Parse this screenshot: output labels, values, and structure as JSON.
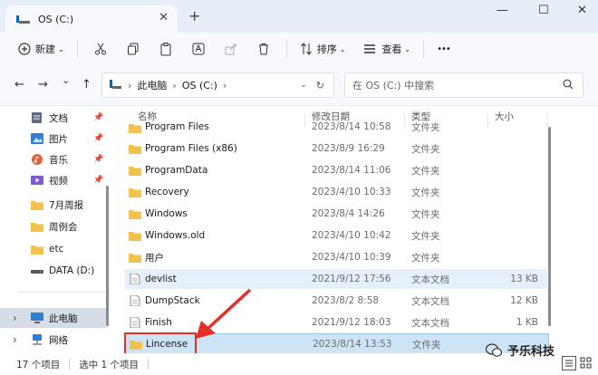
{
  "titlebar": {
    "tab_title": "OS (C:)",
    "close": "✕",
    "new_tab": "+",
    "minimize": "—",
    "maximize": "☐",
    "window_close": "✕"
  },
  "toolbar": {
    "new_label": "新建",
    "sort_label": "排序",
    "view_label": "查看",
    "more": "•••"
  },
  "address": {
    "back": "←",
    "forward": "→",
    "dropdown": "⌄",
    "up": "↑",
    "crumbs": [
      "此电脑",
      "OS (C:)"
    ],
    "sep": "›",
    "refresh": "↻"
  },
  "search": {
    "placeholder": "在 OS (C:) 中搜索"
  },
  "sidebar": {
    "items": [
      {
        "label": "文档",
        "icon": "document-icon",
        "pinned": true
      },
      {
        "label": "图片",
        "icon": "picture-icon",
        "pinned": true
      },
      {
        "label": "音乐",
        "icon": "music-icon",
        "pinned": true
      },
      {
        "label": "视频",
        "icon": "video-icon",
        "pinned": true
      },
      {
        "label": "7月周报",
        "icon": "folder-icon",
        "pinned": false
      },
      {
        "label": "周例会",
        "icon": "folder-icon",
        "pinned": false
      },
      {
        "label": "etc",
        "icon": "folder-icon",
        "pinned": false
      },
      {
        "label": "DATA (D:)",
        "icon": "drive-icon",
        "pinned": false
      },
      {
        "label": "此电脑",
        "icon": "computer-icon",
        "pinned": false,
        "selected": true
      },
      {
        "label": "网络",
        "icon": "network-icon",
        "pinned": false
      }
    ],
    "pin_glyph": "📌",
    "expand_glyph": "›"
  },
  "columns": {
    "name": "名称",
    "date": "修改日期",
    "type": "类型",
    "size": "大小"
  },
  "rows": [
    {
      "name": "Program Files",
      "date": "2023/8/14 10:58",
      "type": "文件夹",
      "size": "",
      "kind": "folder"
    },
    {
      "name": "Program Files (x86)",
      "date": "2023/8/9 16:29",
      "type": "文件夹",
      "size": "",
      "kind": "folder"
    },
    {
      "name": "ProgramData",
      "date": "2023/8/14 11:06",
      "type": "文件夹",
      "size": "",
      "kind": "folder"
    },
    {
      "name": "Recovery",
      "date": "2023/4/10 10:33",
      "type": "文件夹",
      "size": "",
      "kind": "folder"
    },
    {
      "name": "Windows",
      "date": "2023/8/4 14:26",
      "type": "文件夹",
      "size": "",
      "kind": "folder"
    },
    {
      "name": "Windows.old",
      "date": "2023/4/10 10:42",
      "type": "文件夹",
      "size": "",
      "kind": "folder"
    },
    {
      "name": "用户",
      "date": "2023/4/10 10:39",
      "type": "文件夹",
      "size": "",
      "kind": "folder"
    },
    {
      "name": "devlist",
      "date": "2021/9/12 17:56",
      "type": "文本文档",
      "size": "13 KB",
      "kind": "file",
      "highlight": true
    },
    {
      "name": "DumpStack",
      "date": "2023/8/2 8:58",
      "type": "文本文档",
      "size": "12 KB",
      "kind": "file"
    },
    {
      "name": "Finish",
      "date": "2021/9/12 18:03",
      "type": "文本文档",
      "size": "1 KB",
      "kind": "file"
    },
    {
      "name": "Lincense",
      "date": "2023/8/14 13:53",
      "type": "文件夹",
      "size": "",
      "kind": "folder",
      "selected": true
    }
  ],
  "status": {
    "count": "17 个项目",
    "selected": "选中 1 个项目"
  },
  "watermark": {
    "text": "予乐科技"
  },
  "colors": {
    "accent": "#0067c0",
    "folder": "#f2c14e",
    "callout": "#e0302c",
    "selection": "#cde4f7"
  }
}
